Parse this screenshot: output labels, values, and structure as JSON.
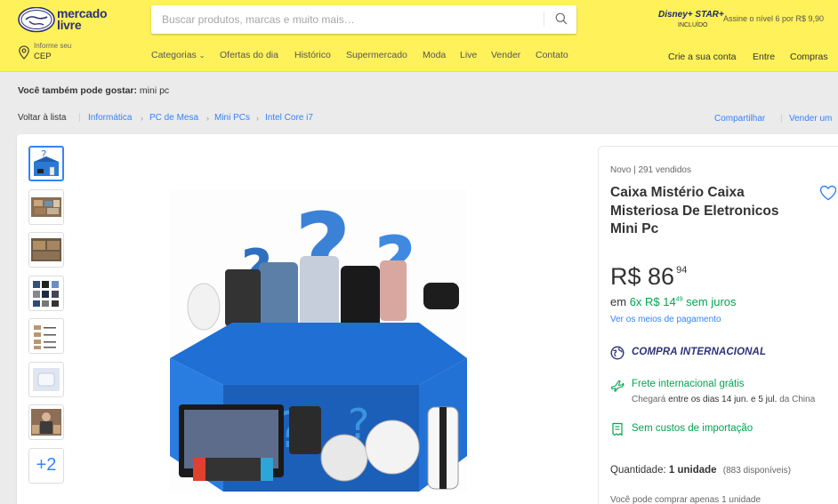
{
  "header": {
    "logo_line1": "mercado",
    "logo_line2": "livre",
    "search_placeholder": "Buscar produtos, marcas e muito mais…",
    "promo": {
      "brand": "Disney+ STAR+",
      "sub": "INCLUÍDO",
      "text": "Assine o nível 6 por R$ 9,90"
    },
    "cep": {
      "line1": "Informe seu",
      "line2": "CEP"
    },
    "nav": [
      "Categorias",
      "Ofertas do dia",
      "Histórico",
      "Supermercado",
      "Moda",
      "Live",
      "Vender",
      "Contato"
    ],
    "account": [
      "Crie a sua conta",
      "Entre",
      "Compras"
    ],
    "colors": {
      "brand_yellow": "#fff159",
      "logo_blue": "#2d3277"
    }
  },
  "suggestions": {
    "label": "Você também pode gostar:",
    "value": "mini pc"
  },
  "breadcrumb": {
    "back": "Voltar à lista",
    "items": [
      "Informática",
      "PC de Mesa",
      "Mini PCs",
      "Intel Core i7"
    ],
    "share": "Compartilhar",
    "sell": "Vender um"
  },
  "gallery": {
    "more_label": "+2"
  },
  "product": {
    "condition": "Novo  |  291 vendidos",
    "title": "Caixa Mistério Caixa Misteriosa De Eletronicos Mini Pc",
    "price_currency": "R$",
    "price_int": "86",
    "price_cents": "94",
    "installments_prefix": "em",
    "installments_count": "6x",
    "installment_value": "R$ 14",
    "installment_cents": "49",
    "installments_suffix": "sem juros",
    "payment_link": "Ver os meios de pagamento",
    "international_badge": "COMPRA INTERNACIONAL",
    "shipping_title": "Frete internacional grátis",
    "shipping_eta_pre": "Chegará",
    "shipping_eta_dates": "entre os dias 14 jun. e 5 jul.",
    "shipping_eta_post": "da China",
    "import_text": "Sem custos de importação",
    "quantity_label": "Quantidade:",
    "quantity_value": "1 unidade",
    "quantity_available": "(883 disponíveis)",
    "purchase_limit": "Você pode comprar apenas 1 unidade",
    "colors": {
      "green": "#00a650",
      "link_blue": "#3483fa"
    }
  }
}
